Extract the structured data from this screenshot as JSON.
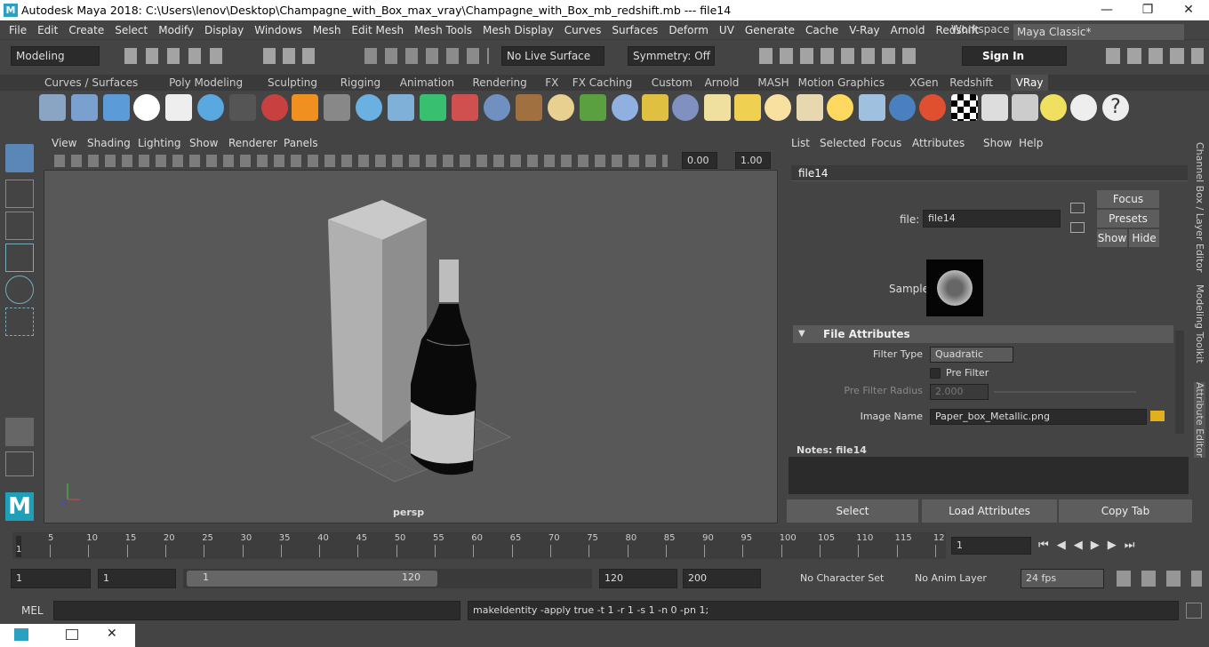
{
  "window": {
    "title": "Autodesk Maya 2018: C:\\Users\\lenov\\Desktop\\Champagne_with_Box_max_vray\\Champagne_with_Box_mb_redshift.mb  ---  file14",
    "minimize": "—",
    "maximize": "❐",
    "close": "✕"
  },
  "menu": [
    "File",
    "Edit",
    "Create",
    "Select",
    "Modify",
    "Display",
    "Windows",
    "Mesh",
    "Edit Mesh",
    "Mesh Tools",
    "Mesh Display",
    "Curves",
    "Surfaces",
    "Deform",
    "UV",
    "Generate",
    "Cache",
    "V-Ray",
    "Arnold",
    "Redshift"
  ],
  "workspace": {
    "label": "Workspace :",
    "value": "Maya Classic*"
  },
  "status": {
    "mode": "Modeling",
    "live": "No Live Surface",
    "symmetry": "Symmetry: Off",
    "signin": "Sign In"
  },
  "shelf_tabs": [
    "Curves / Surfaces",
    "Poly Modeling",
    "Sculpting",
    "Rigging",
    "Animation",
    "Rendering",
    "FX",
    "FX Caching",
    "Custom",
    "Arnold",
    "MASH",
    "Motion Graphics",
    "XGen",
    "Redshift",
    "VRay"
  ],
  "shelf_active": "VRay",
  "viewport": {
    "menu": [
      "View",
      "Shading",
      "Lighting",
      "Show",
      "Renderer",
      "Panels"
    ],
    "camera": "persp",
    "val1": "0.00",
    "val2": "1.00"
  },
  "ae": {
    "menu": [
      "List",
      "Selected",
      "Focus",
      "Attributes",
      "Show",
      "Help"
    ],
    "tab": "file14",
    "file_label": "file:",
    "file_value": "file14",
    "focus": "Focus",
    "presets": "Presets",
    "show": "Show",
    "hide": "Hide",
    "sample": "Sample",
    "section": "File Attributes",
    "filter_type_label": "Filter Type",
    "filter_type": "Quadratic",
    "prefilter": "Pre Filter",
    "prefilter_radius_label": "Pre Filter Radius",
    "prefilter_radius": "2.000",
    "image_name_label": "Image Name",
    "image_name": "Paper_box_Metallic.png",
    "notes": "Notes:  file14",
    "select": "Select",
    "load": "Load Attributes",
    "copy": "Copy Tab"
  },
  "side_tabs": [
    "Channel Box / Layer Editor",
    "Modeling Toolkit",
    "Attribute Editor"
  ],
  "timeline": {
    "ticks": [
      "5",
      "10",
      "15",
      "20",
      "25",
      "30",
      "35",
      "40",
      "45",
      "50",
      "55",
      "60",
      "65",
      "70",
      "75",
      "80",
      "85",
      "90",
      "95",
      "100",
      "105",
      "110",
      "115",
      "12"
    ],
    "current_frame": "1",
    "frame_marker": "1"
  },
  "range": {
    "start": "1",
    "start2": "1",
    "slider_start": "1",
    "slider_end": "120",
    "end": "120",
    "end2": "200",
    "charset": "No Character Set",
    "animlayer": "No Anim Layer",
    "fps": "24 fps"
  },
  "cmd": {
    "lang": "MEL",
    "text": "makeIdentity -apply true -t 1 -r 1 -s 1 -n 0 -pn 1;"
  }
}
